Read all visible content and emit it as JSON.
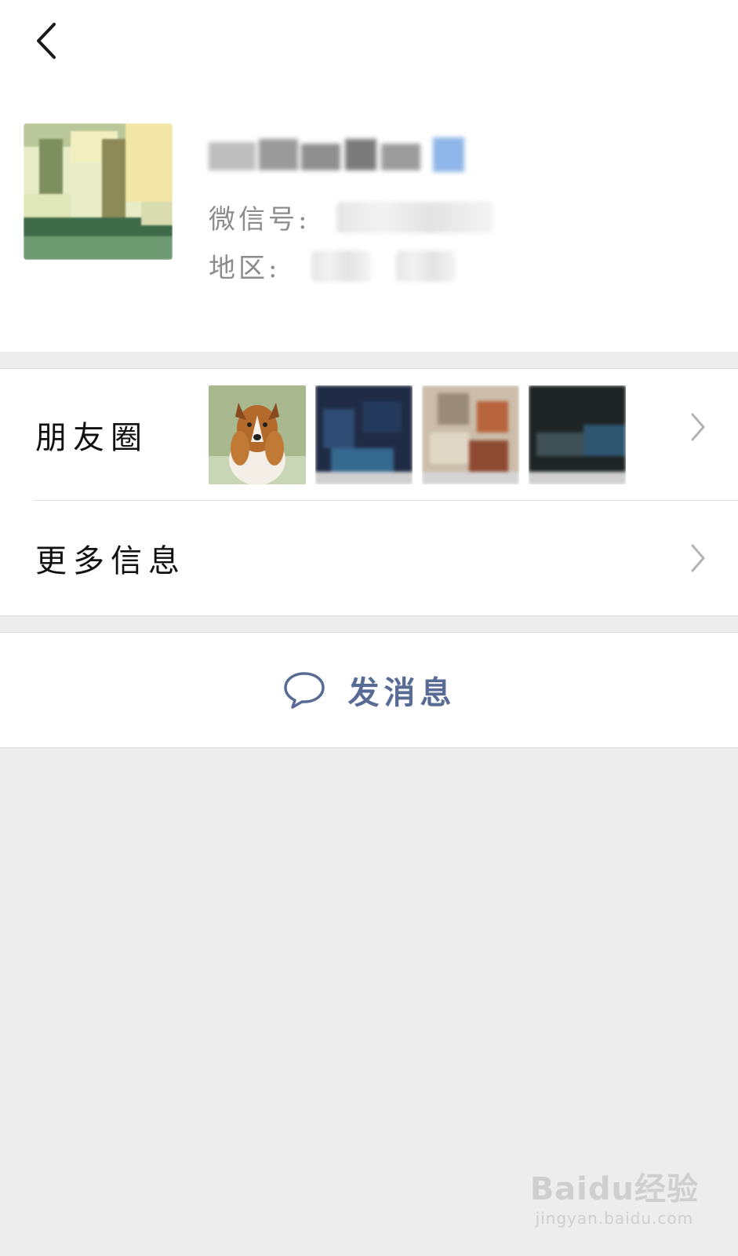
{
  "profile": {
    "wechat_id_label": "微信号:",
    "region_label": "地区:"
  },
  "rows": {
    "moments_label": "朋友圈",
    "more_info_label": "更多信息"
  },
  "actions": {
    "send_message_label": "发消息"
  },
  "watermark": {
    "brand": "Baidu经验",
    "url": "jingyan.baidu.com"
  },
  "colors": {
    "link_blue": "#576b95",
    "background": "#ededed"
  }
}
